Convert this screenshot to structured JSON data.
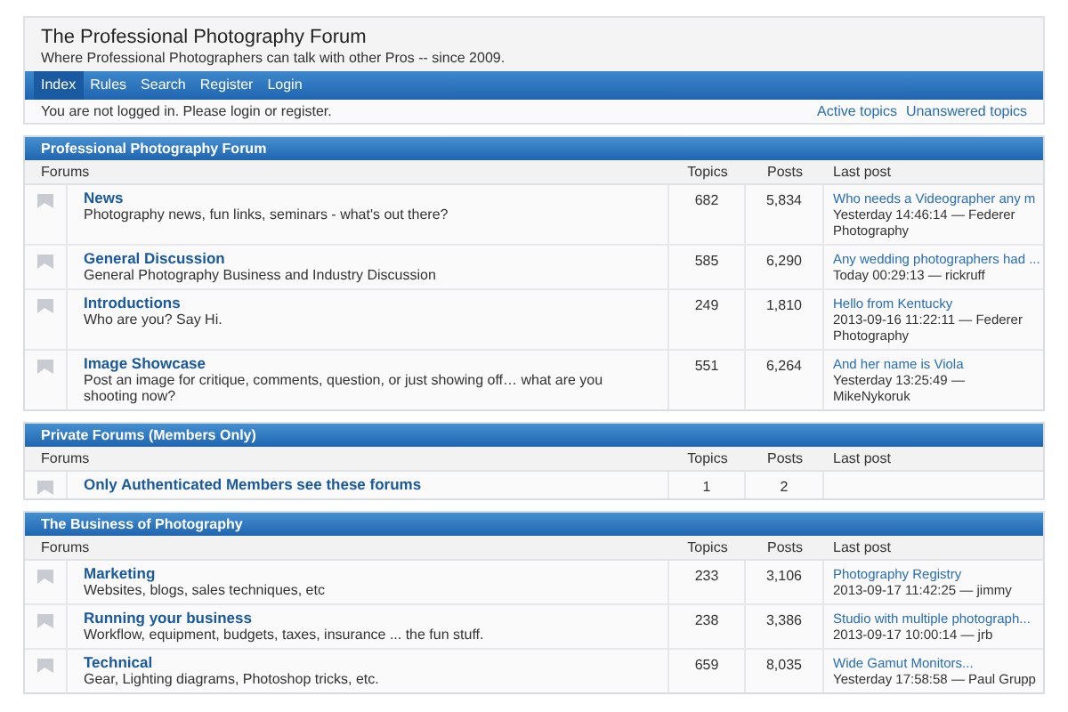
{
  "header": {
    "title": "The Professional Photography Forum",
    "tagline": "Where Professional Photographers can talk with other Pros -- since 2009."
  },
  "nav": [
    {
      "label": "Index",
      "selected": true
    },
    {
      "label": "Rules",
      "selected": false
    },
    {
      "label": "Search",
      "selected": false
    },
    {
      "label": "Register",
      "selected": false
    },
    {
      "label": "Login",
      "selected": false
    }
  ],
  "status": {
    "message": "You are not logged in. Please login or register.",
    "links": [
      "Active topics",
      "Unanswered topics"
    ]
  },
  "sections": [
    {
      "title": "Professional Photography Forum",
      "columns": [
        "Forums",
        "Topics",
        "Posts",
        "Last post"
      ],
      "forums": [
        {
          "name": "News",
          "description": "Photography news, fun links, seminars - what's out there?",
          "topics": "682",
          "posts": "5,834",
          "last_post": {
            "title": "Who needs a Videographer any m",
            "meta": "Yesterday 14:46:14 — Federer Photography"
          }
        },
        {
          "name": "General Discussion",
          "description": "General Photography Business and Industry Discussion",
          "topics": "585",
          "posts": "6,290",
          "last_post": {
            "title": "Any wedding photographers had ...",
            "meta": "Today 00:29:13 — rickruff"
          }
        },
        {
          "name": "Introductions",
          "description": "Who are you? Say Hi.",
          "topics": "249",
          "posts": "1,810",
          "last_post": {
            "title": "Hello from Kentucky",
            "meta": "2013-09-16 11:22:11 — Federer Photography"
          }
        },
        {
          "name": "Image Showcase",
          "description": "Post an image for critique, comments, question, or just showing off… what are you shooting now?",
          "topics": "551",
          "posts": "6,264",
          "last_post": {
            "title": "And her name is Viola",
            "meta": "Yesterday 13:25:49 — MikeNykoruk"
          }
        }
      ]
    },
    {
      "title": "Private Forums (Members Only)",
      "columns": [
        "Forums",
        "Topics",
        "Posts",
        "Last post"
      ],
      "forums": [
        {
          "name": "Only Authenticated Members see these forums",
          "topics": "1",
          "posts": "2"
        }
      ]
    },
    {
      "title": "The Business of Photography",
      "columns": [
        "Forums",
        "Topics",
        "Posts",
        "Last post"
      ],
      "forums": [
        {
          "name": "Marketing",
          "description": "Websites, blogs, sales techniques, etc",
          "topics": "233",
          "posts": "3,106",
          "last_post": {
            "title": "Photography Registry",
            "meta": "2013-09-17 11:42:25 — jimmy"
          }
        },
        {
          "name": "Running your business",
          "description": "Workflow, equipment, budgets, taxes, insurance ... the fun stuff.",
          "topics": "238",
          "posts": "3,386",
          "last_post": {
            "title": "Studio with multiple photograph...",
            "meta": "2013-09-17 10:00:14 — jrb"
          }
        },
        {
          "name": "Technical",
          "description": "Gear, Lighting diagrams, Photoshop tricks, etc.",
          "topics": "659",
          "posts": "8,035",
          "last_post": {
            "title": "Wide Gamut Monitors...",
            "meta": "Yesterday 17:58:58 — Paul Grupp"
          }
        }
      ]
    }
  ]
}
